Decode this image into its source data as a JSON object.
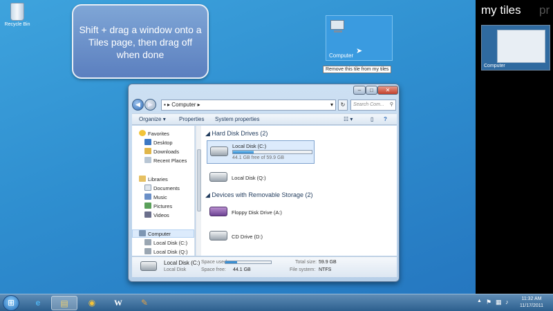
{
  "desktop": {
    "recycle_bin_label": "Recycle Bin",
    "callout_text": "Shift + drag a window onto a Tiles page, then drag off when done",
    "tile": {
      "label": "Computer",
      "tooltip": "Remove this tile from my tiles"
    }
  },
  "explorer": {
    "breadcrumb_root": "Computer",
    "search_placeholder": "Search Com...",
    "toolbar": {
      "organize": "Organize",
      "properties": "Properties",
      "system_properties": "System properties"
    },
    "nav": {
      "favorites": "Favorites",
      "desktop": "Desktop",
      "downloads": "Downloads",
      "recent_places": "Recent Places",
      "libraries": "Libraries",
      "documents": "Documents",
      "music": "Music",
      "pictures": "Pictures",
      "videos": "Videos",
      "computer": "Computer",
      "local_c": "Local Disk (C:)",
      "local_q": "Local Disk (Q:)"
    },
    "groups": {
      "hard_disk": "Hard Disk Drives (2)",
      "removable": "Devices with Removable Storage (2)"
    },
    "drives": {
      "c": {
        "name": "Local Disk (C:)",
        "free_text": "44.1 GB free of 59.9 GB",
        "used_fraction": 0.26
      },
      "q": {
        "name": "Local Disk (Q:)"
      },
      "a": {
        "name": "Floppy Disk Drive (A:)"
      },
      "d": {
        "name": "CD Drive (D:)"
      }
    },
    "details": {
      "name": "Local Disk (C:)",
      "type": "Local Disk",
      "space_used_label": "Space used:",
      "space_free_label": "Space free:",
      "space_free_value": "44.1 GB",
      "total_size_label": "Total size:",
      "total_size_value": "59.9 GB",
      "file_system_label": "File system:",
      "file_system_value": "NTFS"
    }
  },
  "side_panel": {
    "title": "my tiles",
    "next_title": "pr",
    "thumb_label": "Computer"
  },
  "taskbar": {
    "time": "11:32 AM",
    "date": "11/17/2011"
  }
}
